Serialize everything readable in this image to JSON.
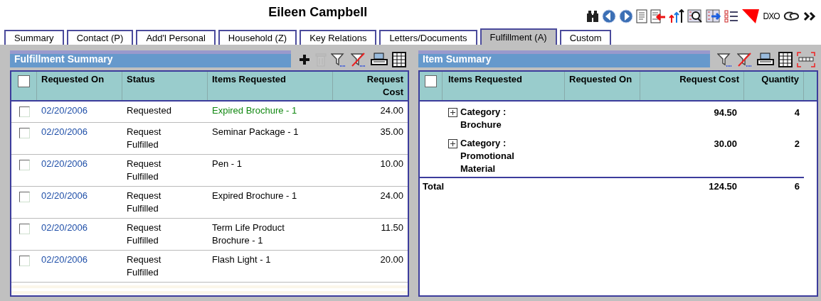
{
  "window": {
    "title": "Eileen Campbell"
  },
  "toolbar": {
    "text_button": "DXO"
  },
  "tabs": [
    {
      "label": "Summary",
      "selected": false
    },
    {
      "label": "Contact (P)",
      "selected": false
    },
    {
      "label": "Add'l Personal",
      "selected": false
    },
    {
      "label": "Household (Z)",
      "selected": false
    },
    {
      "label": "Key Relations",
      "selected": false
    },
    {
      "label": "Letters/Documents",
      "selected": false
    },
    {
      "label": "Fulfillment (A)",
      "selected": true
    },
    {
      "label": "Custom",
      "selected": false
    }
  ],
  "fulfillment_summary": {
    "title": "Fulfillment Summary",
    "tools": [
      {
        "disabled": false
      },
      {
        "disabled": true
      },
      {
        "disabled": false
      },
      {
        "disabled": false
      },
      {
        "disabled": false
      },
      {
        "disabled": false
      }
    ],
    "select_all": {
      "checked": false
    },
    "columns": [
      "Requested On",
      "Status",
      "Items Requested",
      "Request Cost"
    ],
    "rows": [
      {
        "checked": false,
        "requested_on": "02/20/2006",
        "status": "Requested",
        "item": "Expired Brochure - 1",
        "highlighted": true,
        "cost": "24.00"
      },
      {
        "checked": false,
        "requested_on": "02/20/2006",
        "status": "Request Fulfilled",
        "item": "Seminar Package - 1",
        "highlighted": false,
        "cost": "35.00"
      },
      {
        "checked": false,
        "requested_on": "02/20/2006",
        "status": "Request Fulfilled",
        "item": "Pen - 1",
        "highlighted": false,
        "cost": "10.00"
      },
      {
        "checked": false,
        "requested_on": "02/20/2006",
        "status": "Request Fulfilled",
        "item": "Expired Brochure - 1",
        "highlighted": false,
        "cost": "24.00"
      },
      {
        "checked": false,
        "requested_on": "02/20/2006",
        "status": "Request Fulfilled",
        "item": "Term Life Product Brochure - 1",
        "highlighted": false,
        "cost": "11.50"
      },
      {
        "checked": false,
        "requested_on": "02/20/2006",
        "status": "Request Fulfilled",
        "item": "Flash Light - 1",
        "highlighted": false,
        "cost": "20.00"
      }
    ]
  },
  "item_summary": {
    "title": "Item Summary",
    "tools": [
      {
        "disabled": false
      },
      {
        "disabled": false
      },
      {
        "disabled": false
      },
      {
        "disabled": false
      },
      {
        "disabled": false
      }
    ],
    "select_all": {
      "checked": false
    },
    "columns": [
      "Items Requested",
      "Requested On",
      "Request Cost",
      "Quantity"
    ],
    "rows": [
      {
        "expanded": false,
        "item": "Category : Brochure",
        "cost": "94.50",
        "quantity": "4"
      },
      {
        "expanded": false,
        "item": "Category : Promotional Material",
        "cost": "30.00",
        "quantity": "2"
      }
    ],
    "total": {
      "label": "Total",
      "cost": "124.50",
      "quantity": "6"
    }
  }
}
